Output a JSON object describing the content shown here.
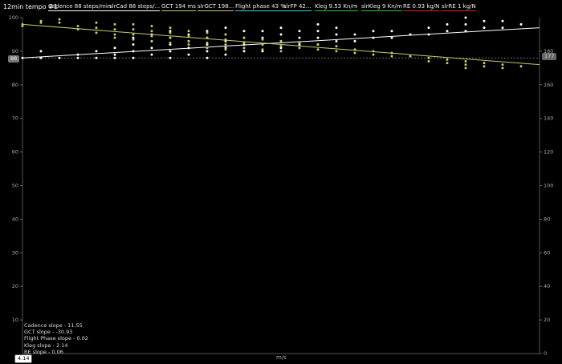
{
  "title": "12min tempo #1",
  "legend": [
    {
      "label": "Cadence  88 steps/min",
      "color": "#ffffff"
    },
    {
      "label": "slrCad  88 steps/...",
      "color": "#ffffff"
    },
    {
      "label": "GCT  194 ms",
      "color": "#c8c86a"
    },
    {
      "label": "slrGCT  198...",
      "color": "#c8c86a"
    },
    {
      "label": "Flight phase  43 %",
      "color": "#2ad0d8"
    },
    {
      "label": "slrFP  42...",
      "color": "#2ad0d8"
    },
    {
      "label": "Kleg  9.53 Kn/m",
      "color": "#2fc43a"
    },
    {
      "label": "slrKleg  9 Kn/m",
      "color": "#2fc43a"
    },
    {
      "label": "RE  0.93 kg/N",
      "color": "#e0202a"
    },
    {
      "label": "slrRE  1 kg/N",
      "color": "#e0202a"
    }
  ],
  "badges": {
    "x": "4.14",
    "left": "88",
    "right": "177"
  },
  "slopes": [
    "Cadence slope - 11.55",
    "GCT slope - -30.93",
    "Flight Phase slope - 0.02",
    "Kleg slope - 2.14",
    "RE slope - 0.06"
  ],
  "xlabel": "m/s",
  "colors": {
    "cadence": "#ffffff",
    "gct": "#c8c86a",
    "background": "#000000"
  },
  "chart_data": {
    "type": "scatter",
    "title": "12min tempo #1",
    "xlabel": "m/s",
    "ylabel": "",
    "xlim": [
      4.14,
      4.7
    ],
    "ylim_left": [
      0,
      100
    ],
    "ylim_right": [
      0,
      200
    ],
    "left_ticks": [
      10,
      20,
      30,
      40,
      50,
      60,
      70,
      80,
      90,
      100
    ],
    "right_ticks": [
      0,
      20,
      40,
      60,
      80,
      100,
      120,
      140,
      160,
      180
    ],
    "grid": false,
    "legend_position": "top",
    "series": [
      {
        "name": "Cadence",
        "axis": "left",
        "color": "#ffffff",
        "points": [
          [
            4.14,
            88
          ],
          [
            4.16,
            88
          ],
          [
            4.16,
            90
          ],
          [
            4.18,
            88
          ],
          [
            4.2,
            88
          ],
          [
            4.2,
            89
          ],
          [
            4.22,
            88
          ],
          [
            4.22,
            90
          ],
          [
            4.24,
            88
          ],
          [
            4.24,
            89
          ],
          [
            4.24,
            91
          ],
          [
            4.26,
            88
          ],
          [
            4.26,
            90
          ],
          [
            4.26,
            92
          ],
          [
            4.26,
            94
          ],
          [
            4.28,
            89
          ],
          [
            4.28,
            91
          ],
          [
            4.28,
            93
          ],
          [
            4.28,
            95
          ],
          [
            4.3,
            88
          ],
          [
            4.3,
            90
          ],
          [
            4.3,
            92
          ],
          [
            4.3,
            94
          ],
          [
            4.3,
            96
          ],
          [
            4.32,
            89
          ],
          [
            4.32,
            91
          ],
          [
            4.32,
            93
          ],
          [
            4.32,
            95
          ],
          [
            4.34,
            88
          ],
          [
            4.34,
            90
          ],
          [
            4.34,
            92
          ],
          [
            4.34,
            94
          ],
          [
            4.34,
            96
          ],
          [
            4.36,
            89
          ],
          [
            4.36,
            91
          ],
          [
            4.36,
            93
          ],
          [
            4.36,
            95
          ],
          [
            4.36,
            97
          ],
          [
            4.38,
            90
          ],
          [
            4.38,
            92
          ],
          [
            4.38,
            94
          ],
          [
            4.38,
            96
          ],
          [
            4.4,
            90
          ],
          [
            4.4,
            92
          ],
          [
            4.4,
            94
          ],
          [
            4.4,
            96
          ],
          [
            4.42,
            91
          ],
          [
            4.42,
            93
          ],
          [
            4.42,
            95
          ],
          [
            4.42,
            97
          ],
          [
            4.44,
            92
          ],
          [
            4.44,
            94
          ],
          [
            4.44,
            96
          ],
          [
            4.46,
            92
          ],
          [
            4.46,
            94
          ],
          [
            4.46,
            96
          ],
          [
            4.46,
            98
          ],
          [
            4.48,
            93
          ],
          [
            4.48,
            95
          ],
          [
            4.48,
            97
          ],
          [
            4.5,
            93
          ],
          [
            4.5,
            95
          ],
          [
            4.52,
            94
          ],
          [
            4.52,
            96
          ],
          [
            4.54,
            94
          ],
          [
            4.54,
            96
          ],
          [
            4.56,
            95
          ],
          [
            4.58,
            95
          ],
          [
            4.58,
            97
          ],
          [
            4.6,
            96
          ],
          [
            4.6,
            98
          ],
          [
            4.62,
            96
          ],
          [
            4.62,
            98
          ],
          [
            4.62,
            100
          ],
          [
            4.64,
            97
          ],
          [
            4.64,
            99
          ],
          [
            4.66,
            97
          ],
          [
            4.66,
            99
          ],
          [
            4.68,
            98
          ]
        ],
        "trend": [
          [
            4.14,
            88
          ],
          [
            4.7,
            97
          ]
        ]
      },
      {
        "name": "GCT",
        "axis": "right",
        "color": "#c8c86a",
        "points": [
          [
            4.14,
            195
          ],
          [
            4.14,
            196
          ],
          [
            4.16,
            198
          ],
          [
            4.16,
            197
          ],
          [
            4.18,
            199
          ],
          [
            4.18,
            197
          ],
          [
            4.2,
            195
          ],
          [
            4.2,
            193
          ],
          [
            4.22,
            197
          ],
          [
            4.22,
            194
          ],
          [
            4.22,
            191
          ],
          [
            4.24,
            196
          ],
          [
            4.24,
            193
          ],
          [
            4.24,
            190
          ],
          [
            4.24,
            188
          ],
          [
            4.26,
            196
          ],
          [
            4.26,
            193
          ],
          [
            4.26,
            190
          ],
          [
            4.26,
            187
          ],
          [
            4.28,
            195
          ],
          [
            4.28,
            192
          ],
          [
            4.28,
            189
          ],
          [
            4.28,
            186
          ],
          [
            4.3,
            194
          ],
          [
            4.3,
            191
          ],
          [
            4.3,
            188
          ],
          [
            4.3,
            185
          ],
          [
            4.32,
            192
          ],
          [
            4.32,
            189
          ],
          [
            4.32,
            186
          ],
          [
            4.32,
            184
          ],
          [
            4.34,
            191
          ],
          [
            4.34,
            188
          ],
          [
            4.34,
            185
          ],
          [
            4.34,
            182
          ],
          [
            4.36,
            190
          ],
          [
            4.36,
            187
          ],
          [
            4.36,
            184
          ],
          [
            4.36,
            181
          ],
          [
            4.38,
            188
          ],
          [
            4.38,
            185
          ],
          [
            4.38,
            182
          ],
          [
            4.4,
            187
          ],
          [
            4.4,
            184
          ],
          [
            4.4,
            181
          ],
          [
            4.42,
            186
          ],
          [
            4.42,
            183
          ],
          [
            4.42,
            180
          ],
          [
            4.44,
            185
          ],
          [
            4.44,
            182
          ],
          [
            4.46,
            184
          ],
          [
            4.46,
            181
          ],
          [
            4.48,
            183
          ],
          [
            4.48,
            180
          ],
          [
            4.5,
            181
          ],
          [
            4.5,
            179
          ],
          [
            4.52,
            180
          ],
          [
            4.52,
            178
          ],
          [
            4.54,
            179
          ],
          [
            4.54,
            177
          ],
          [
            4.56,
            177
          ],
          [
            4.58,
            176
          ],
          [
            4.58,
            174
          ],
          [
            4.6,
            175
          ],
          [
            4.6,
            173
          ],
          [
            4.62,
            174
          ],
          [
            4.62,
            172
          ],
          [
            4.62,
            170
          ],
          [
            4.64,
            173
          ],
          [
            4.64,
            171
          ],
          [
            4.66,
            172
          ],
          [
            4.66,
            170
          ],
          [
            4.68,
            171
          ]
        ],
        "trend": [
          [
            4.14,
            196
          ],
          [
            4.7,
            172
          ]
        ]
      }
    ]
  }
}
